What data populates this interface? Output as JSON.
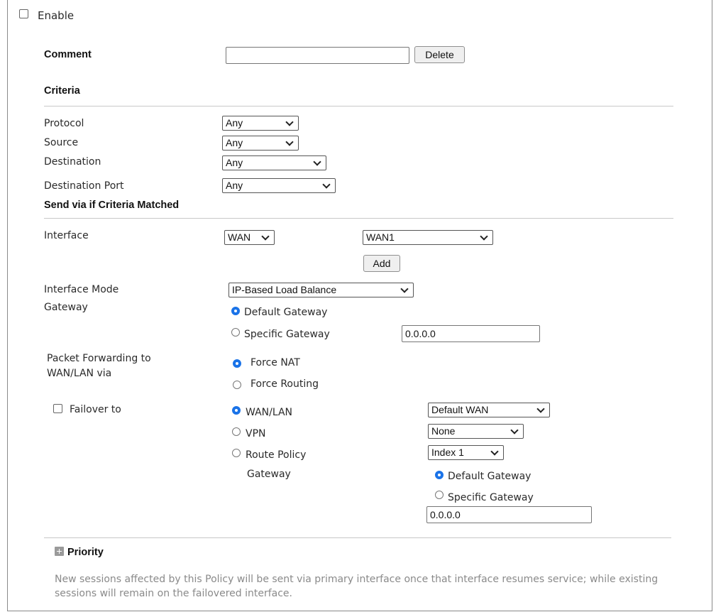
{
  "enable": {
    "label": "Enable",
    "checked": false
  },
  "comment": {
    "label": "Comment",
    "value": "",
    "delete_label": "Delete"
  },
  "criteria": {
    "heading": "Criteria",
    "protocol": {
      "label": "Protocol",
      "value": "Any"
    },
    "source": {
      "label": "Source",
      "value": "Any"
    },
    "destination": {
      "label": "Destination",
      "value": "Any"
    },
    "destination_port": {
      "label": "Destination Port",
      "value": "Any"
    }
  },
  "send_via": {
    "heading": "Send via if Criteria Matched",
    "interface": {
      "label": "Interface",
      "type_value": "WAN",
      "wan_value": "WAN1",
      "add_label": "Add"
    },
    "interface_mode": {
      "label": "Interface Mode",
      "value": "IP-Based Load Balance"
    },
    "gateway": {
      "label": "Gateway",
      "default_label": "Default Gateway",
      "specific_label": "Specific Gateway",
      "specific_value": "0.0.0.0",
      "selected": "default"
    },
    "packet_forwarding": {
      "label_line1": "Packet Forwarding to",
      "label_line2": "WAN/LAN via",
      "force_nat_label": "Force NAT",
      "force_routing_label": "Force Routing",
      "selected": "force_nat"
    },
    "failover": {
      "label": "Failover to",
      "checked": false,
      "wan_lan_label": "WAN/LAN",
      "wan_lan_value": "Default WAN",
      "vpn_label": "VPN",
      "vpn_value": "None",
      "route_policy_label": "Route Policy",
      "route_policy_value": "Index 1",
      "gateway_label": "Gateway",
      "default_gateway_label": "Default Gateway",
      "specific_gateway_label": "Specific Gateway",
      "specific_gateway_value": "0.0.0.0",
      "selected": "wan_lan",
      "gateway_selected": "default"
    }
  },
  "priority": {
    "label": "Priority",
    "note": "New sessions affected by this Policy will be sent via primary interface once that interface resumes service; while existing sessions will remain on the failovered interface."
  },
  "colors": {
    "accent": "#1a73e8",
    "note_text": "#8a8a8a",
    "divider": "#c8c8c8"
  }
}
